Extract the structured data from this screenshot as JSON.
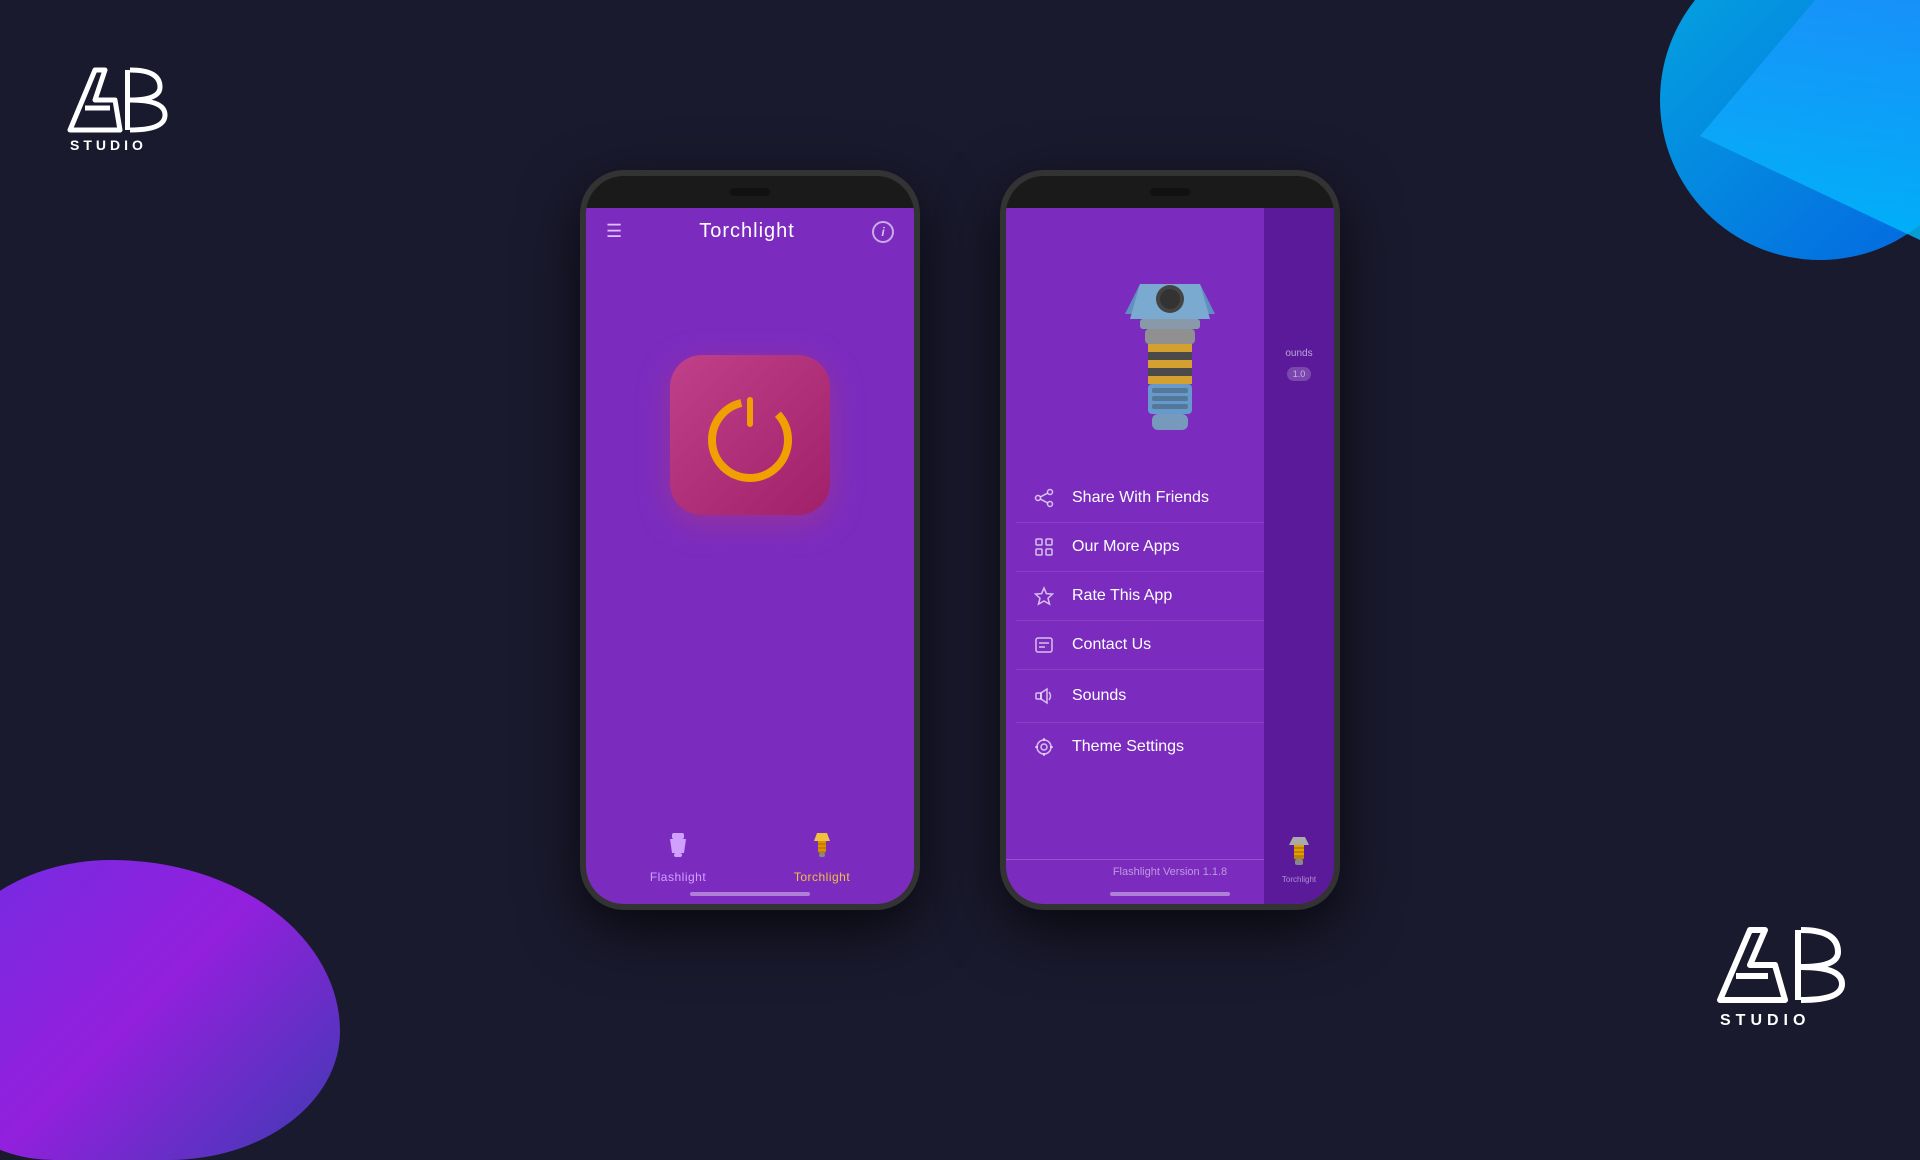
{
  "app": {
    "title": "Torchlight",
    "version_text": "Flashlight Version 1.1.8"
  },
  "phone1": {
    "header": {
      "title": "Torchlight",
      "info_label": "i"
    },
    "nav": [
      {
        "label": "Flashlight",
        "active": false
      },
      {
        "label": "Torchlight",
        "active": true
      }
    ]
  },
  "phone2": {
    "menu_items": [
      {
        "icon": "share",
        "label": "Share With Friends",
        "has_toggle": false
      },
      {
        "icon": "grid",
        "label": "Our More Apps",
        "has_toggle": false
      },
      {
        "icon": "star",
        "label": "Rate This App",
        "has_toggle": false
      },
      {
        "icon": "contact",
        "label": "Contact Us",
        "has_toggle": false
      },
      {
        "icon": "sound",
        "label": "Sounds",
        "has_toggle": true,
        "toggle_on": true
      },
      {
        "icon": "theme",
        "label": "Theme Settings",
        "has_toggle": false
      }
    ],
    "version": "Flashlight Version 1.1.8",
    "sidebar_peek": {
      "label": "ounds",
      "badge": "1.0"
    }
  },
  "brand": {
    "name": "AB STUDIO"
  }
}
